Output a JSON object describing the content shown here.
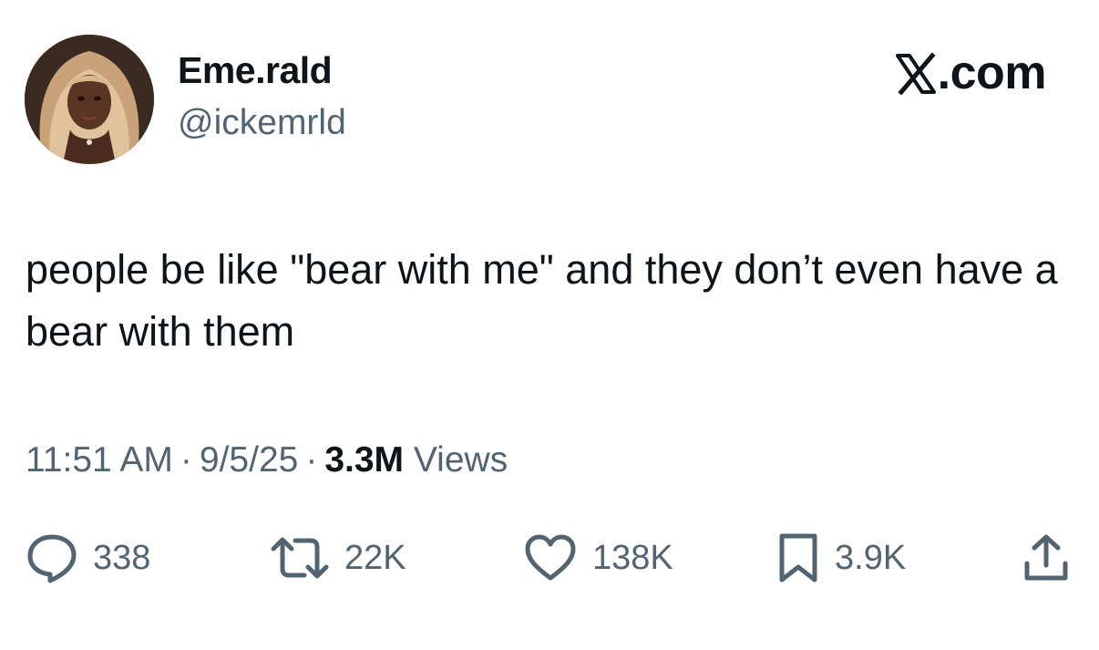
{
  "author": {
    "display_name": "Eme.rald",
    "handle": "@ickemrld"
  },
  "brand": {
    "suffix": ".com",
    "logo_icon": "x-logo-icon"
  },
  "tweet": {
    "text": "people be like \"bear with me\" and they don’t even have a bear with them"
  },
  "meta": {
    "time": "11:51 AM",
    "separator": "·",
    "date": "9/5/25",
    "views_count": "3.3M",
    "views_label": "Views"
  },
  "actions": {
    "replies": {
      "icon": "reply-icon",
      "count": "338"
    },
    "reposts": {
      "icon": "retweet-icon",
      "count": "22K"
    },
    "likes": {
      "icon": "heart-icon",
      "count": "138K"
    },
    "bookmarks": {
      "icon": "bookmark-icon",
      "count": "3.9K"
    },
    "share": {
      "icon": "share-icon"
    }
  },
  "colors": {
    "text_primary": "#0f1419",
    "text_secondary": "#536471",
    "background": "#ffffff"
  }
}
